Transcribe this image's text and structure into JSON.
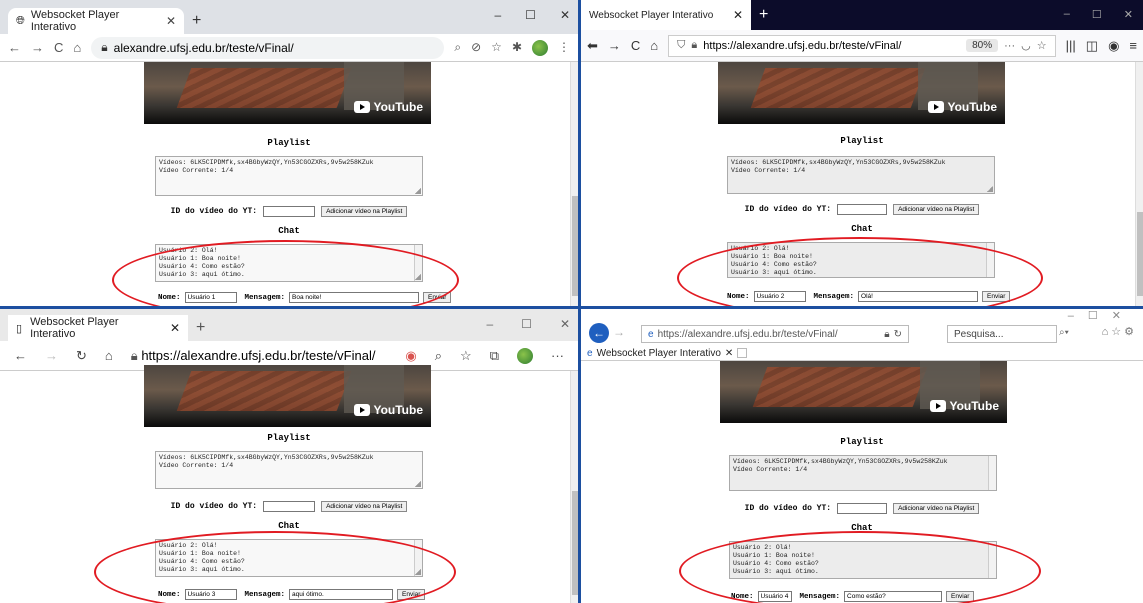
{
  "page_title": "Websocket Player Interativo",
  "url_display": "alexandre.ufsj.edu.br/teste/vFinal/",
  "url_full": "https://alexandre.ufsj.edu.br/teste/vFinal/",
  "url_host": "alexandre.ufsj.edu.br",
  "url_path": "/teste/vFinal/",
  "video_logo_text": "YouTube",
  "playlist_heading": "Playlist",
  "playlist_text": "Vídeos: 6LK5CIPDMfk,sx4BGbyWzQY,Yn53CGOZXRs,9v5w258KZuk\nVídeo Corrente: 1/4",
  "id_label": "ID do vídeo do YT:",
  "add_button": "Adicionar vídeo na Playlist",
  "chat_heading": "Chat",
  "chat_log": "Usuário 2: Olá!\nUsuário 1: Boa noite!\nUsuário 4: Como estão?\nUsuário 3: aqui ótimo.",
  "name_label": "Nome:",
  "message_label": "Mensagem:",
  "send_button": "Enviar",
  "firefox_zoom": "80%",
  "ie_search_placeholder": "Pesquisa...",
  "panes": [
    {
      "browser": "Chrome",
      "name_value": "Usuário 1",
      "message_value": "Boa noite!"
    },
    {
      "browser": "Firefox",
      "name_value": "Usuário 2",
      "message_value": "Olá!"
    },
    {
      "browser": "Edge",
      "name_value": "Usuário 3",
      "message_value": "aqui ótimo."
    },
    {
      "browser": "Internet Explorer",
      "name_value": "Usuário 4",
      "message_value": "Como estão?"
    }
  ],
  "colors": {
    "annotation_ring": "#e11b22",
    "desktop_divider": "#1c4fa0"
  }
}
